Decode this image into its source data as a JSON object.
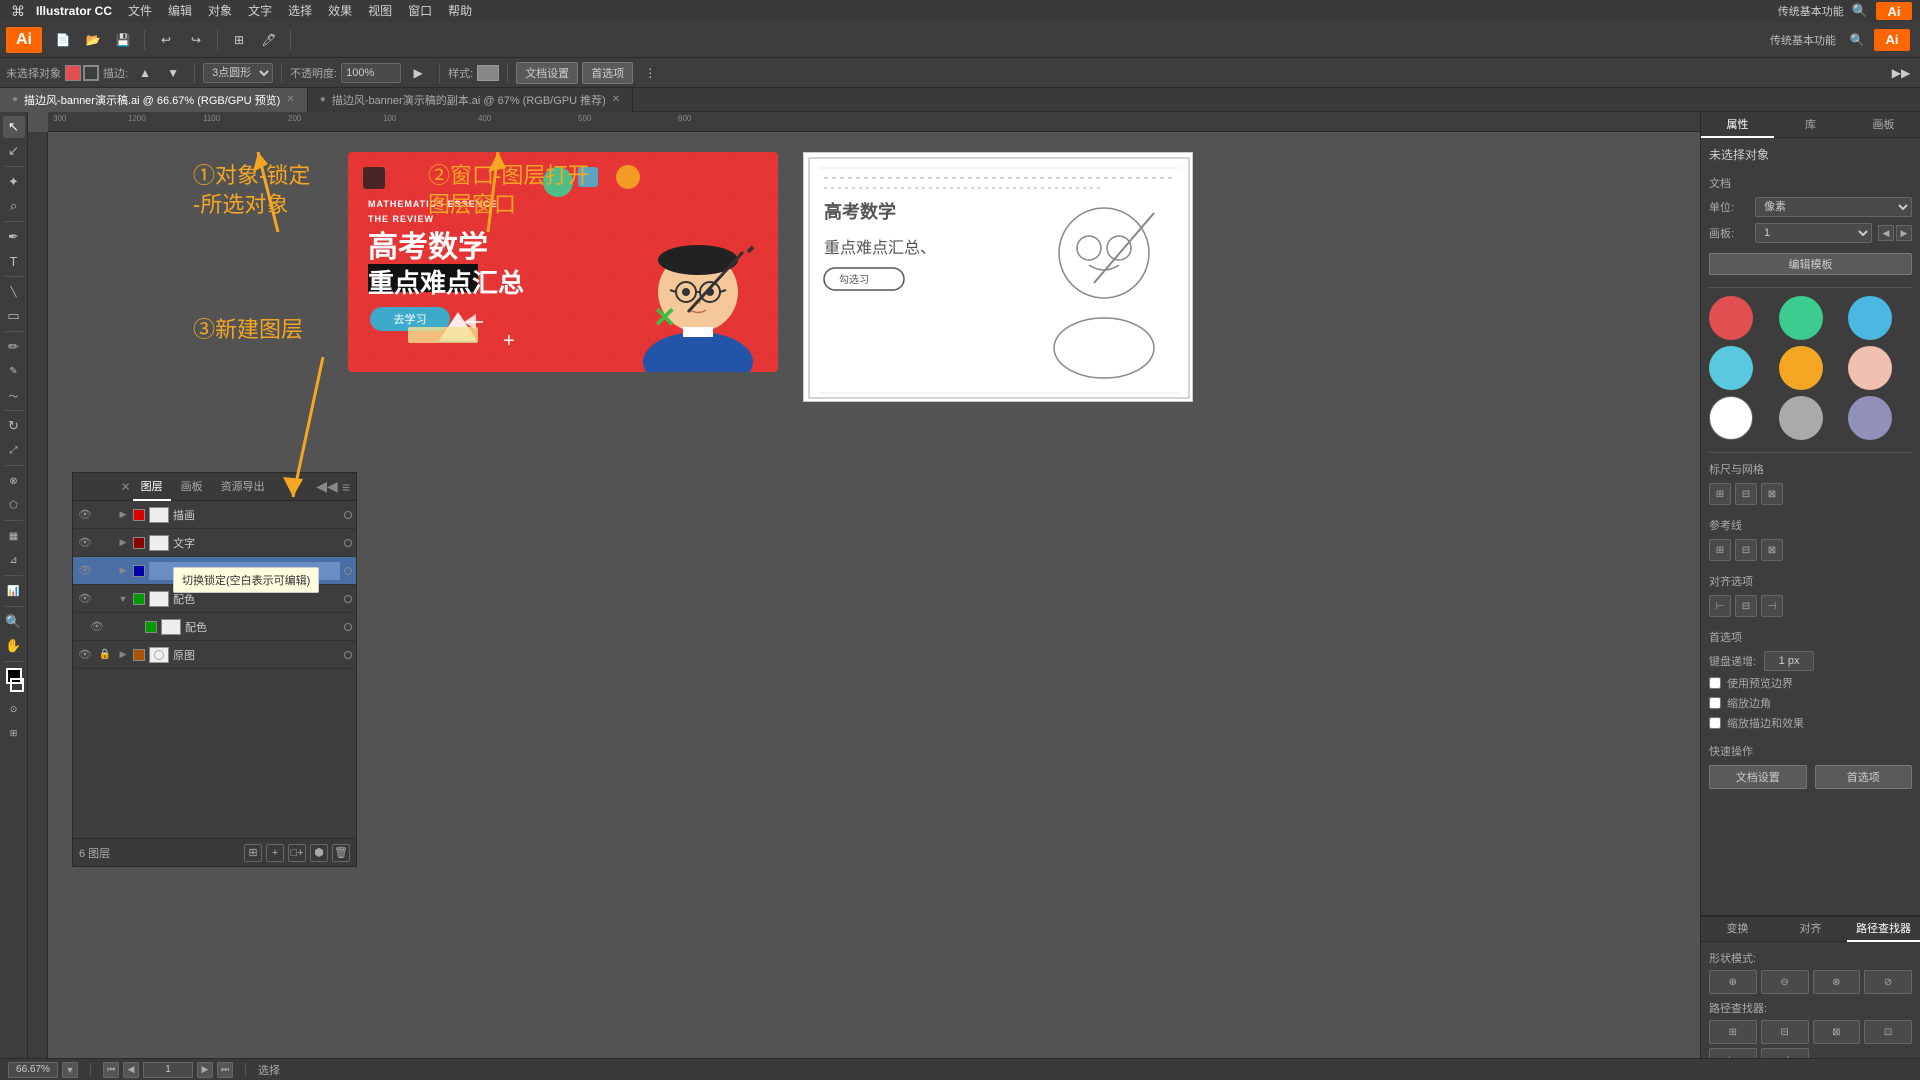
{
  "app": {
    "name": "Illustrator CC",
    "logo": "Ai",
    "logo_color": "#ff6600"
  },
  "menubar": {
    "apple": "⌘",
    "items": [
      "Illustrator CC",
      "文件",
      "编辑",
      "对象",
      "文字",
      "选择",
      "效果",
      "视图",
      "窗口",
      "帮助"
    ]
  },
  "toolbar": {
    "new_doc": "新建",
    "zoom_label": "66.67%",
    "selection_label": "未选择对象",
    "stroke_label": "描边:",
    "shape_select": "3点圆形",
    "opacity_label": "不透明度:",
    "opacity_value": "100%",
    "style_label": "样式:",
    "doc_settings": "文档设置",
    "prefs_label": "首选项",
    "search_placeholder": "搜索",
    "top_right_feature": "传统基本功能"
  },
  "tabs": [
    {
      "label": "描边风-banner演示稿.ai @ 66.67% (RGB/GPU 预览)",
      "active": true
    },
    {
      "label": "描边风-banner演示稿的副本.ai @ 67% (RGB/GPU 推荐)",
      "active": false
    }
  ],
  "toolbox": {
    "tools": [
      {
        "name": "selection",
        "icon": "↖",
        "active": true
      },
      {
        "name": "direct-selection",
        "icon": "↙"
      },
      {
        "name": "magic-wand",
        "icon": "✦"
      },
      {
        "name": "lasso",
        "icon": "⌕"
      },
      {
        "name": "pen",
        "icon": "✒"
      },
      {
        "name": "type",
        "icon": "T"
      },
      {
        "name": "line",
        "icon": "╲"
      },
      {
        "name": "shape",
        "icon": "▭"
      },
      {
        "name": "paintbrush",
        "icon": "✏"
      },
      {
        "name": "pencil",
        "icon": "✎"
      },
      {
        "name": "rotate",
        "icon": "↻"
      },
      {
        "name": "scale",
        "icon": "⤢"
      },
      {
        "name": "blend",
        "icon": "⊗"
      },
      {
        "name": "gradient",
        "icon": "▦"
      },
      {
        "name": "eyedropper",
        "icon": "⊿"
      },
      {
        "name": "crop",
        "icon": "⊡"
      },
      {
        "name": "zoom",
        "icon": "🔍"
      },
      {
        "name": "hand",
        "icon": "✋"
      }
    ]
  },
  "annotations": {
    "ann1_text": "①对象-锁定\n-所选对象",
    "ann2_text": "②窗口-图层打开\n图层窗口",
    "ann3_text": "③新建图层"
  },
  "layers_panel": {
    "tabs": [
      "图层",
      "画板",
      "资源导出"
    ],
    "active_tab": "图层",
    "layers": [
      {
        "name": "描画",
        "visible": true,
        "locked": false,
        "color": "#d00",
        "has_thumb": false,
        "expanded": false
      },
      {
        "name": "文字",
        "visible": true,
        "locked": false,
        "color": "#900",
        "has_thumb": false,
        "expanded": false
      },
      {
        "name": "",
        "visible": true,
        "locked": false,
        "color": "#00a",
        "renaming": true,
        "expanded": false
      },
      {
        "name": "配色",
        "visible": true,
        "locked": false,
        "color": "#090",
        "expanded": true,
        "children": [
          {
            "name": "配色",
            "visible": true,
            "locked": false,
            "color": "#090"
          }
        ]
      },
      {
        "name": "原图",
        "visible": true,
        "locked": true,
        "color": "#a50",
        "expanded": false,
        "has_thumb": true
      }
    ],
    "layer_count": "6 图层",
    "tooltip": "切换锁定(空白表示可编辑)"
  },
  "banner": {
    "subtitle": "MATHEMATICS ESSENCE THE REVIEW",
    "title": "高考数学\n重点难点汇总",
    "button": "去学习",
    "bg_color": "#e63535"
  },
  "right_panel": {
    "top_tabs": [
      "属性",
      "库",
      "画板"
    ],
    "active_tab": "属性",
    "no_selection": "未选择对象",
    "document_section": "文档",
    "unit_label": "单位:",
    "unit_value": "像素",
    "artboard_label": "画板:",
    "artboard_value": "1",
    "edit_template_btn": "编辑模板",
    "rulers_label": "标尺与网格",
    "guidelines_label": "参考线",
    "align_label": "对齐选项",
    "prefs_label": "首选项",
    "keyboard_increment_label": "键盘递增:",
    "keyboard_increment_value": "1 px",
    "use_preview_bounds": "使用预览边界",
    "use_corners": "缩放边角",
    "scale_strokes": "缩放描边和效果",
    "quick_actions_label": "快速操作",
    "doc_settings_btn": "文档设置",
    "prefs_btn": "首选项",
    "colors": [
      {
        "hex": "#e05050",
        "name": "red"
      },
      {
        "hex": "#3dcca0",
        "name": "teal"
      },
      {
        "hex": "#4ab8e0",
        "name": "light-blue"
      },
      {
        "hex": "#5ac8e0",
        "name": "sky-blue"
      },
      {
        "hex": "#f5a623",
        "name": "orange"
      },
      {
        "hex": "#f0c0b0",
        "name": "peach"
      },
      {
        "hex": "#ffffff",
        "name": "white"
      },
      {
        "hex": "#aaaaaa",
        "name": "gray"
      },
      {
        "hex": "#9090b8",
        "name": "lavender"
      }
    ],
    "bottom_tabs": [
      "变换",
      "对齐",
      "路径查找器"
    ],
    "active_bottom_tab": "路径查找器",
    "shape_modes_label": "形状模式:",
    "pathfinder_label": "路径查找器:"
  },
  "statusbar": {
    "zoom": "66.67%",
    "page": "1",
    "tool": "选择"
  }
}
